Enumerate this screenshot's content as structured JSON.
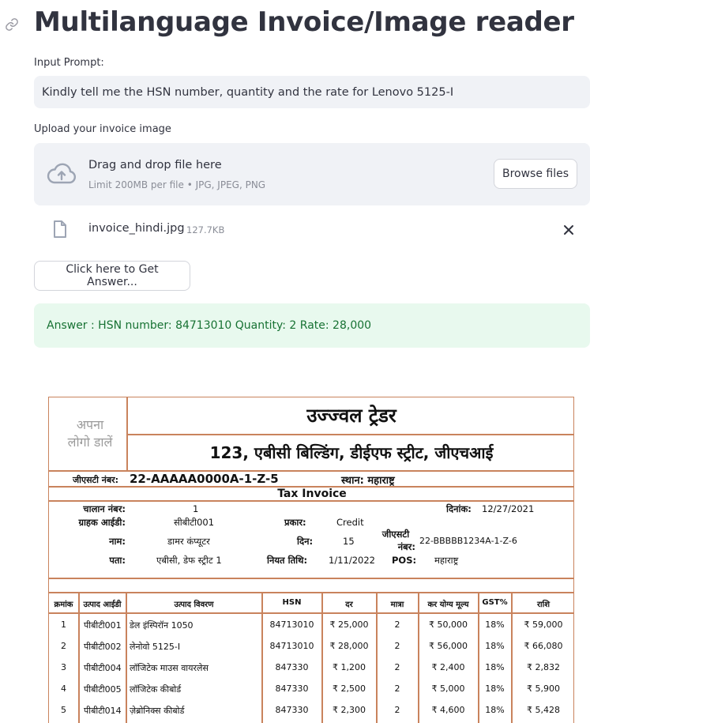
{
  "page": {
    "title": "Multilanguage Invoice/Image reader"
  },
  "prompt": {
    "label": "Input Prompt:",
    "value": "Kindly tell me the HSN number, quantity and the rate for Lenovo 5125-I"
  },
  "upload": {
    "label": "Upload your invoice image",
    "drop_text": "Drag and drop file here",
    "limit_text": "Limit 200MB per file • JPG, JPEG, PNG",
    "browse_label": "Browse files",
    "file_name": "invoice_hindi.jpg",
    "file_size": "127.7KB"
  },
  "action": {
    "button_label": "Click here to Get Answer..."
  },
  "answer": {
    "text": "Answer : HSN number: 84713010 Quantity: 2 Rate: 28,000"
  },
  "invoice": {
    "logo_line1": "अपना",
    "logo_line2": "लोगो डालें",
    "company": "उज्ज्वल ट्रेडर",
    "address": "123, एबीसी बिल्डिंग, डीईएफ स्ट्रीट, जीएचआई",
    "gst_label": "जीएसटी नंबर:",
    "gst_value": "22-AAAAA0000A-1-Z-5",
    "place": "स्थान: महाराष्ट्र",
    "tax_invoice": "Tax Invoice",
    "invoice_no_label": "चालान नंबर:",
    "invoice_no": "1",
    "date_label": "दिनांक:",
    "date": "12/27/2021",
    "customer_id_label": "ग्राहक आईडी:",
    "customer_id": "सीबीटी001",
    "type_label": "प्रकार:",
    "type": "Credit",
    "name_label": "नाम:",
    "name": "डामर कंप्यूटर",
    "days_label": "दिन:",
    "days": "15",
    "cust_gst_label1": "जीएसटी",
    "cust_gst_label2": "नंबर:",
    "cust_gst": "22-BBBBB1234A-1-Z-6",
    "address_label": "पता:",
    "cust_address": "एबीसी, डेफ स्ट्रीट 1",
    "due_label": "नियत तिथि:",
    "due": "1/11/2022",
    "pos_label": "POS:",
    "pos": "महाराष्ट्र",
    "headers": [
      "क्रमांक",
      "उत्पाद आईडी",
      "उत्पाद विवरण",
      "HSN",
      "दर",
      "मात्रा",
      "कर योग्य मूल्य",
      "GST%",
      "राशि"
    ],
    "rows": [
      [
        "1",
        "पीबीटी001",
        "डेल इंस्पिरॉन 1050",
        "84713010",
        "₹ 25,000",
        "2",
        "₹ 50,000",
        "18%",
        "₹ 59,000"
      ],
      [
        "2",
        "पीबीटी002",
        "लेनोवो 5125-I",
        "84713010",
        "₹ 28,000",
        "2",
        "₹ 56,000",
        "18%",
        "₹ 66,080"
      ],
      [
        "3",
        "पीबीटी004",
        "लॉजिटेक माउस वायरलेस",
        "847330",
        "₹ 1,200",
        "2",
        "₹ 2,400",
        "18%",
        "₹ 2,832"
      ],
      [
        "4",
        "पीबीटी005",
        "लॉजिटेक कीबोर्ड",
        "847330",
        "₹ 2,500",
        "2",
        "₹ 5,000",
        "18%",
        "₹ 5,900"
      ],
      [
        "5",
        "पीबीटी014",
        "ज़ेब्रोनिक्स कीबोर्ड",
        "847330",
        "₹ 2,300",
        "2",
        "₹ 4,600",
        "18%",
        "₹ 5,428"
      ]
    ]
  }
}
